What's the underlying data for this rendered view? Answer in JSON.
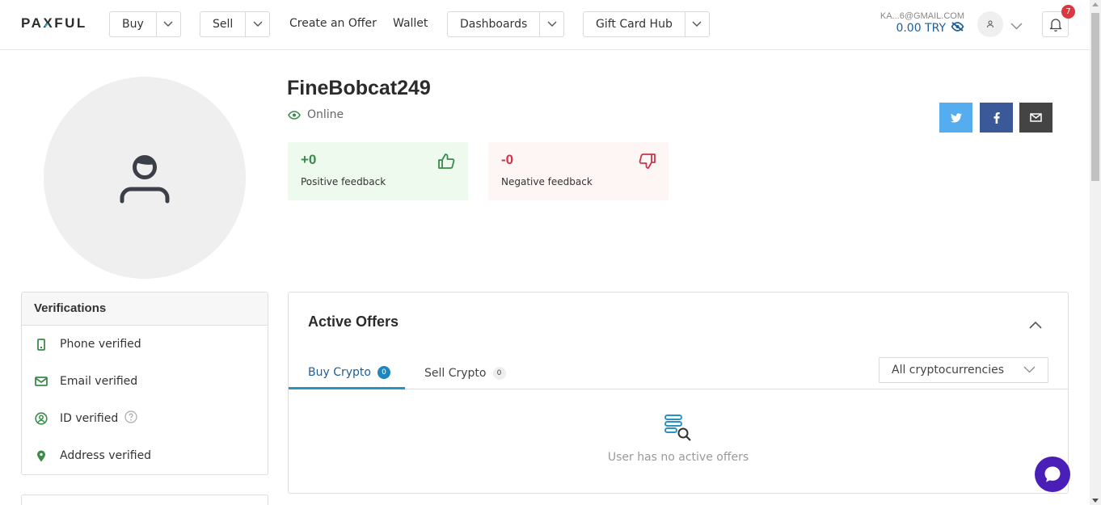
{
  "header": {
    "logo": "PAXFUL",
    "nav": {
      "buy": "Buy",
      "sell": "Sell",
      "create_offer": "Create an Offer",
      "wallet": "Wallet",
      "dashboards": "Dashboards",
      "gift_card_hub": "Gift Card Hub"
    },
    "account": {
      "email": "KA...6@GMAIL.COM",
      "balance": "0.00 TRY"
    },
    "notifications_count": "7"
  },
  "profile": {
    "username": "FineBobcat249",
    "status": "Online",
    "feedback": {
      "positive": {
        "value": "+0",
        "label": "Positive feedback"
      },
      "negative": {
        "value": "-0",
        "label": "Negative feedback"
      }
    },
    "share": [
      "twitter",
      "facebook",
      "email"
    ]
  },
  "verifications": {
    "title": "Verifications",
    "items": [
      {
        "label": "Phone verified",
        "icon": "phone-icon"
      },
      {
        "label": "Email verified",
        "icon": "mail-icon"
      },
      {
        "label": "ID verified",
        "icon": "id-icon"
      },
      {
        "label": "Address verified",
        "icon": "location-pin-icon"
      }
    ]
  },
  "offers": {
    "title": "Active Offers",
    "tabs": [
      {
        "label": "Buy Crypto",
        "count": "0",
        "active": true
      },
      {
        "label": "Sell Crypto",
        "count": "0",
        "active": false
      }
    ],
    "filter": "All cryptocurrencies",
    "empty_message": "User has no active offers"
  },
  "colors": {
    "positive": "#3a8a4a",
    "negative": "#c7364a",
    "link": "#1b5e9a",
    "tab_accent": "#2a92c2",
    "chat": "#4a1fb8"
  }
}
